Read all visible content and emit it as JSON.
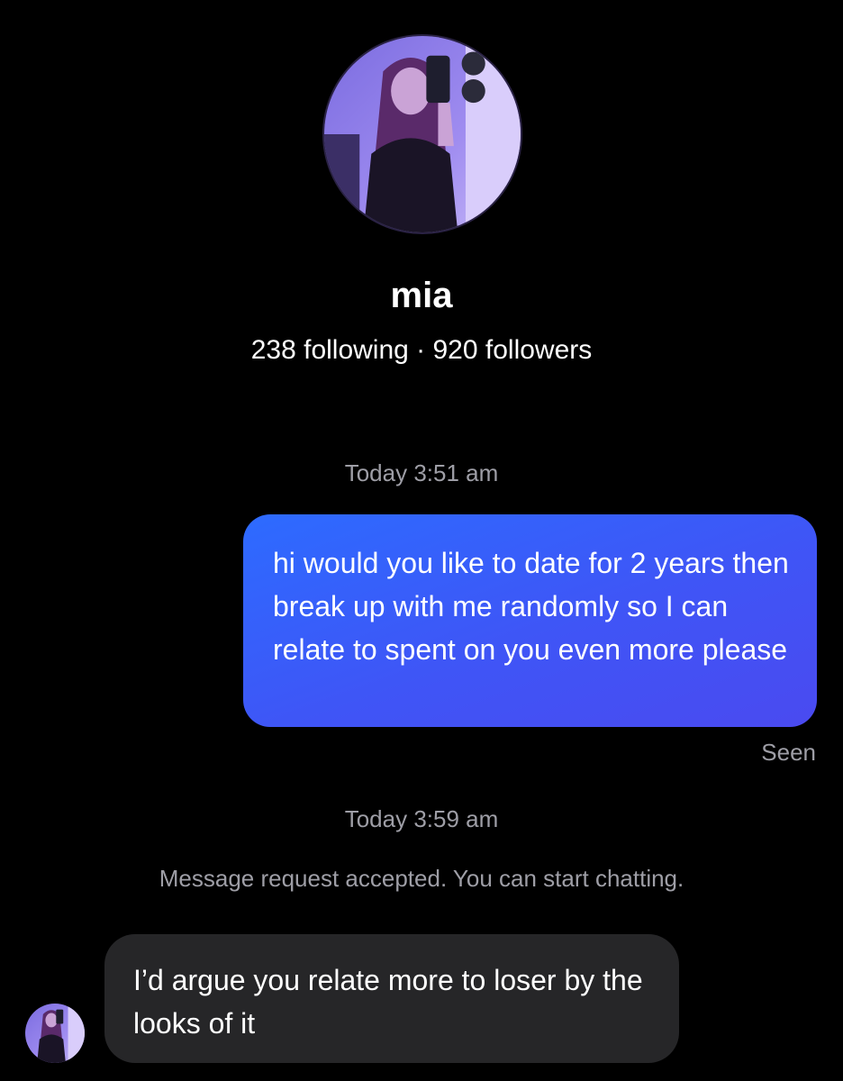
{
  "profile": {
    "name": "mia",
    "stats": "238 following · 920 followers"
  },
  "thread": {
    "timestamp_1": "Today 3:51 am",
    "sent_message": "hi would you like to date for 2 years then break up with me randomly so I can relate to spent on you even more please",
    "seen_status": "Seen",
    "timestamp_2": "Today 3:59 am",
    "system_notice": "Message request accepted. You can start chatting.",
    "received_message": "I’d argue you relate more to loser by the looks of it"
  },
  "colors": {
    "background": "#000000",
    "sent_bubble": "#3a5cf7",
    "received_bubble": "#262628",
    "secondary_text": "#9e9ea6"
  }
}
